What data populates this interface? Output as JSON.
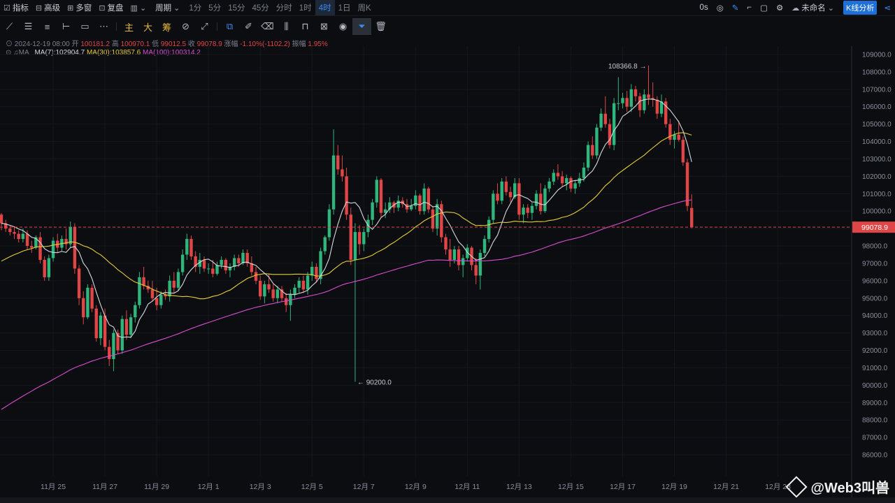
{
  "toolbar": {
    "indicators": "指标",
    "advanced": "高级",
    "multiwindow": "多窗",
    "replay": "复盘",
    "period": "周期",
    "intervals": [
      "1分",
      "5分",
      "15分",
      "45分",
      "分时",
      "1时",
      "4时",
      "1日",
      "周K"
    ],
    "active_interval": "4时",
    "seconds": "0s",
    "unnamed": "未命名",
    "kline_analysis": "K线分析"
  },
  "drawtools": {
    "main": "主",
    "big": "大",
    "chips": "筹"
  },
  "ohlc_bar": {
    "datetime": "2024-12-19 08:00",
    "open_label": "开",
    "open": "100181.2",
    "high_label": "高",
    "high": "100970.1",
    "low_label": "低",
    "low": "99012.5",
    "close_label": "收",
    "close": "99078.9",
    "change_label": "涨幅",
    "change": "-1.10%(-1102.2)",
    "amplitude_label": "振幅",
    "amplitude": "1.95%"
  },
  "ma_bar": {
    "label": "MA",
    "ma7": "MA(7):102904.7",
    "ma30": "MA(30):103857.6",
    "ma100": "MA(100):100314.2"
  },
  "watermark": "@Web3叫兽",
  "chart_data": {
    "type": "candlestick",
    "ylim": [
      85500,
      109500
    ],
    "y_ticks": [
      86000,
      87000,
      88000,
      89000,
      90000,
      91000,
      92000,
      93000,
      94000,
      95000,
      96000,
      97000,
      98000,
      99000,
      100000,
      101000,
      102000,
      103000,
      104000,
      105000,
      106000,
      107000,
      108000,
      109000
    ],
    "x_ticks": [
      "11月 25",
      "11月 27",
      "11月 29",
      "12月 1",
      "12月 3",
      "12月 5",
      "12月 7",
      "12月 9",
      "12月 11",
      "12月 13",
      "12月 15",
      "12月 17",
      "12月 19",
      "12月 21",
      "12月 23"
    ],
    "current_price": "99078.9",
    "high_annotation": "108366.8",
    "low_annotation": "90200.0",
    "colors": {
      "up": "#2eb67d",
      "down": "#e04646",
      "ma7": "#d7d9de",
      "ma30": "#e6cd3a",
      "ma100": "#d84dd0",
      "bg": "#0c0d11"
    },
    "candles": [
      [
        99800,
        99900,
        98900,
        99300
      ],
      [
        99300,
        99500,
        98800,
        99000
      ],
      [
        99000,
        99200,
        98600,
        98800
      ],
      [
        98800,
        99100,
        98400,
        98700
      ],
      [
        98700,
        98900,
        98200,
        98400
      ],
      [
        98400,
        99000,
        98200,
        98700
      ],
      [
        98700,
        98900,
        97800,
        98000
      ],
      [
        98000,
        98300,
        97600,
        97900
      ],
      [
        97900,
        98600,
        97800,
        98500
      ],
      [
        98500,
        98800,
        97000,
        97200
      ],
      [
        97200,
        97400,
        96000,
        96200
      ],
      [
        96200,
        97500,
        96000,
        97300
      ],
      [
        97300,
        98500,
        97100,
        98300
      ],
      [
        98300,
        98700,
        97600,
        97900
      ],
      [
        97900,
        98600,
        97700,
        98400
      ],
      [
        98400,
        99000,
        97800,
        98100
      ],
      [
        98100,
        99400,
        97900,
        99100
      ],
      [
        99100,
        99300,
        96400,
        96700
      ],
      [
        96700,
        96900,
        94600,
        95000
      ],
      [
        95000,
        95400,
        93500,
        93900
      ],
      [
        93900,
        95800,
        93800,
        95600
      ],
      [
        95600,
        95800,
        94200,
        94400
      ],
      [
        94400,
        94600,
        92500,
        92700
      ],
      [
        92700,
        94200,
        92300,
        94000
      ],
      [
        94000,
        94400,
        92000,
        92200
      ],
      [
        92200,
        92600,
        91100,
        91500
      ],
      [
        91500,
        93200,
        90800,
        93000
      ],
      [
        93000,
        93200,
        91800,
        92000
      ],
      [
        92000,
        94000,
        91800,
        93800
      ],
      [
        93800,
        94300,
        92600,
        92900
      ],
      [
        92900,
        94100,
        92700,
        93900
      ],
      [
        93900,
        94800,
        93600,
        94600
      ],
      [
        94600,
        96500,
        94400,
        96200
      ],
      [
        96200,
        96800,
        95500,
        95700
      ],
      [
        95700,
        96000,
        95300,
        95500
      ],
      [
        95500,
        96000,
        94800,
        95000
      ],
      [
        95000,
        95600,
        94300,
        94600
      ],
      [
        94600,
        95400,
        94400,
        95200
      ],
      [
        95200,
        95500,
        94900,
        95100
      ],
      [
        95100,
        96300,
        94800,
        96000
      ],
      [
        96000,
        96500,
        95300,
        95600
      ],
      [
        95600,
        96700,
        95400,
        96500
      ],
      [
        96500,
        97800,
        96300,
        97500
      ],
      [
        97500,
        98700,
        97200,
        98400
      ],
      [
        98400,
        98600,
        97200,
        97400
      ],
      [
        97400,
        97700,
        96500,
        96800
      ],
      [
        96800,
        97600,
        96400,
        97200
      ],
      [
        97200,
        97400,
        96500,
        96700
      ],
      [
        96700,
        97000,
        96400,
        96700
      ],
      [
        96700,
        97200,
        96200,
        96400
      ],
      [
        96400,
        97100,
        96300,
        96900
      ],
      [
        96900,
        97400,
        96700,
        97200
      ],
      [
        97200,
        97300,
        96400,
        96600
      ],
      [
        96600,
        97000,
        96200,
        96800
      ],
      [
        96800,
        97500,
        96600,
        97300
      ],
      [
        97300,
        97500,
        96800,
        97000
      ],
      [
        97000,
        97800,
        96900,
        97600
      ],
      [
        97600,
        97800,
        96800,
        97000
      ],
      [
        97000,
        97400,
        96300,
        96500
      ],
      [
        96500,
        96800,
        95800,
        96000
      ],
      [
        96000,
        96300,
        94900,
        95100
      ],
      [
        95100,
        96000,
        94700,
        95800
      ],
      [
        95800,
        96400,
        95300,
        95500
      ],
      [
        95500,
        95800,
        94800,
        95000
      ],
      [
        95000,
        95700,
        94700,
        95500
      ],
      [
        95500,
        95700,
        94800,
        95000
      ],
      [
        95000,
        95300,
        94200,
        94600
      ],
      [
        94600,
        95500,
        93700,
        95200
      ],
      [
        95200,
        95800,
        95000,
        95600
      ],
      [
        95600,
        96200,
        95300,
        96000
      ],
      [
        96000,
        96300,
        95300,
        95500
      ],
      [
        95500,
        96500,
        95200,
        96300
      ],
      [
        96300,
        97100,
        96000,
        96800
      ],
      [
        96800,
        97000,
        95900,
        96100
      ],
      [
        96100,
        97900,
        95800,
        97700
      ],
      [
        97700,
        98600,
        97500,
        98500
      ],
      [
        98500,
        100400,
        98300,
        100100
      ],
      [
        100100,
        104700,
        99800,
        103200
      ],
      [
        103200,
        103800,
        102100,
        102400
      ],
      [
        102400,
        103200,
        101700,
        102000
      ],
      [
        102000,
        102500,
        99500,
        99800
      ],
      [
        99800,
        100200,
        96900,
        97200
      ],
      [
        97200,
        99300,
        90200,
        98800
      ],
      [
        98800,
        99200,
        97500,
        98100
      ],
      [
        98100,
        99000,
        97700,
        98800
      ],
      [
        98800,
        99800,
        98500,
        99500
      ],
      [
        99500,
        100700,
        99200,
        100500
      ],
      [
        100500,
        102000,
        100200,
        101800
      ],
      [
        101800,
        101900,
        99600,
        99900
      ],
      [
        99900,
        100500,
        99600,
        100100
      ],
      [
        100100,
        100800,
        99900,
        100500
      ],
      [
        100500,
        100600,
        99900,
        100200
      ],
      [
        100200,
        100900,
        100000,
        100600
      ],
      [
        100600,
        100800,
        100200,
        100400
      ],
      [
        100400,
        100700,
        99900,
        100100
      ],
      [
        100100,
        100700,
        100000,
        100300
      ],
      [
        100300,
        101200,
        100100,
        100900
      ],
      [
        100900,
        101000,
        99800,
        100000
      ],
      [
        100000,
        101600,
        99800,
        101300
      ],
      [
        101300,
        101400,
        99900,
        100100
      ],
      [
        100100,
        100300,
        98800,
        99000
      ],
      [
        99000,
        100700,
        98600,
        100400
      ],
      [
        100400,
        100600,
        98200,
        98500
      ],
      [
        98500,
        98700,
        97500,
        97800
      ],
      [
        97800,
        98400,
        96800,
        97200
      ],
      [
        97200,
        98000,
        97000,
        97800
      ],
      [
        97800,
        98000,
        96600,
        96900
      ],
      [
        96900,
        97500,
        96200,
        97300
      ],
      [
        97300,
        98100,
        97100,
        97900
      ],
      [
        97900,
        98000,
        96600,
        96900
      ],
      [
        96900,
        97300,
        95800,
        96300
      ],
      [
        96300,
        97800,
        95500,
        97600
      ],
      [
        97600,
        98600,
        97400,
        98400
      ],
      [
        98400,
        99700,
        98200,
        99500
      ],
      [
        99500,
        101200,
        99300,
        101000
      ],
      [
        101000,
        101600,
        100400,
        100600
      ],
      [
        100600,
        101900,
        100400,
        101700
      ],
      [
        101700,
        102000,
        100900,
        101100
      ],
      [
        101100,
        101400,
        100500,
        100800
      ],
      [
        100800,
        101900,
        100700,
        101600
      ],
      [
        101600,
        101900,
        99500,
        99800
      ],
      [
        99800,
        100400,
        99300,
        100200
      ],
      [
        100200,
        100400,
        99600,
        99900
      ],
      [
        99900,
        100500,
        99500,
        100300
      ],
      [
        100300,
        101200,
        100100,
        101000
      ],
      [
        101000,
        101600,
        99800,
        100000
      ],
      [
        100000,
        101500,
        99900,
        101300
      ],
      [
        101300,
        101900,
        101100,
        101700
      ],
      [
        101700,
        102400,
        101500,
        102200
      ],
      [
        102200,
        102700,
        101800,
        102000
      ],
      [
        102000,
        102300,
        101400,
        101600
      ],
      [
        101600,
        102100,
        101200,
        101900
      ],
      [
        101900,
        102000,
        101100,
        101300
      ],
      [
        101300,
        101800,
        101000,
        101600
      ],
      [
        101600,
        102200,
        101400,
        101900
      ],
      [
        101900,
        102800,
        101700,
        102500
      ],
      [
        102500,
        104000,
        102300,
        103800
      ],
      [
        103800,
        104300,
        103000,
        103200
      ],
      [
        103200,
        105000,
        103000,
        104800
      ],
      [
        104800,
        105900,
        104600,
        105600
      ],
      [
        105600,
        106600,
        104800,
        105000
      ],
      [
        105000,
        105300,
        103600,
        103800
      ],
      [
        103800,
        106500,
        103500,
        106200
      ],
      [
        106200,
        107700,
        105800,
        106200
      ],
      [
        106200,
        106800,
        105900,
        106500
      ],
      [
        106500,
        106900,
        105700,
        106000
      ],
      [
        106000,
        107300,
        105700,
        107000
      ],
      [
        107000,
        107200,
        106300,
        106600
      ],
      [
        106600,
        106800,
        105400,
        105800
      ],
      [
        105800,
        107000,
        105600,
        106700
      ],
      [
        106700,
        108366,
        106100,
        106500
      ],
      [
        106500,
        107400,
        106000,
        106400
      ],
      [
        106400,
        106600,
        105300,
        105600
      ],
      [
        105600,
        106700,
        105400,
        106300
      ],
      [
        106300,
        106500,
        104800,
        105000
      ],
      [
        105000,
        105300,
        103800,
        104100
      ],
      [
        104100,
        104600,
        103600,
        104400
      ],
      [
        104400,
        105200,
        104000,
        104100
      ],
      [
        104100,
        104300,
        102600,
        102800
      ],
      [
        102800,
        103000,
        100000,
        100300
      ],
      [
        100181,
        100970,
        99012,
        99078
      ]
    ]
  }
}
